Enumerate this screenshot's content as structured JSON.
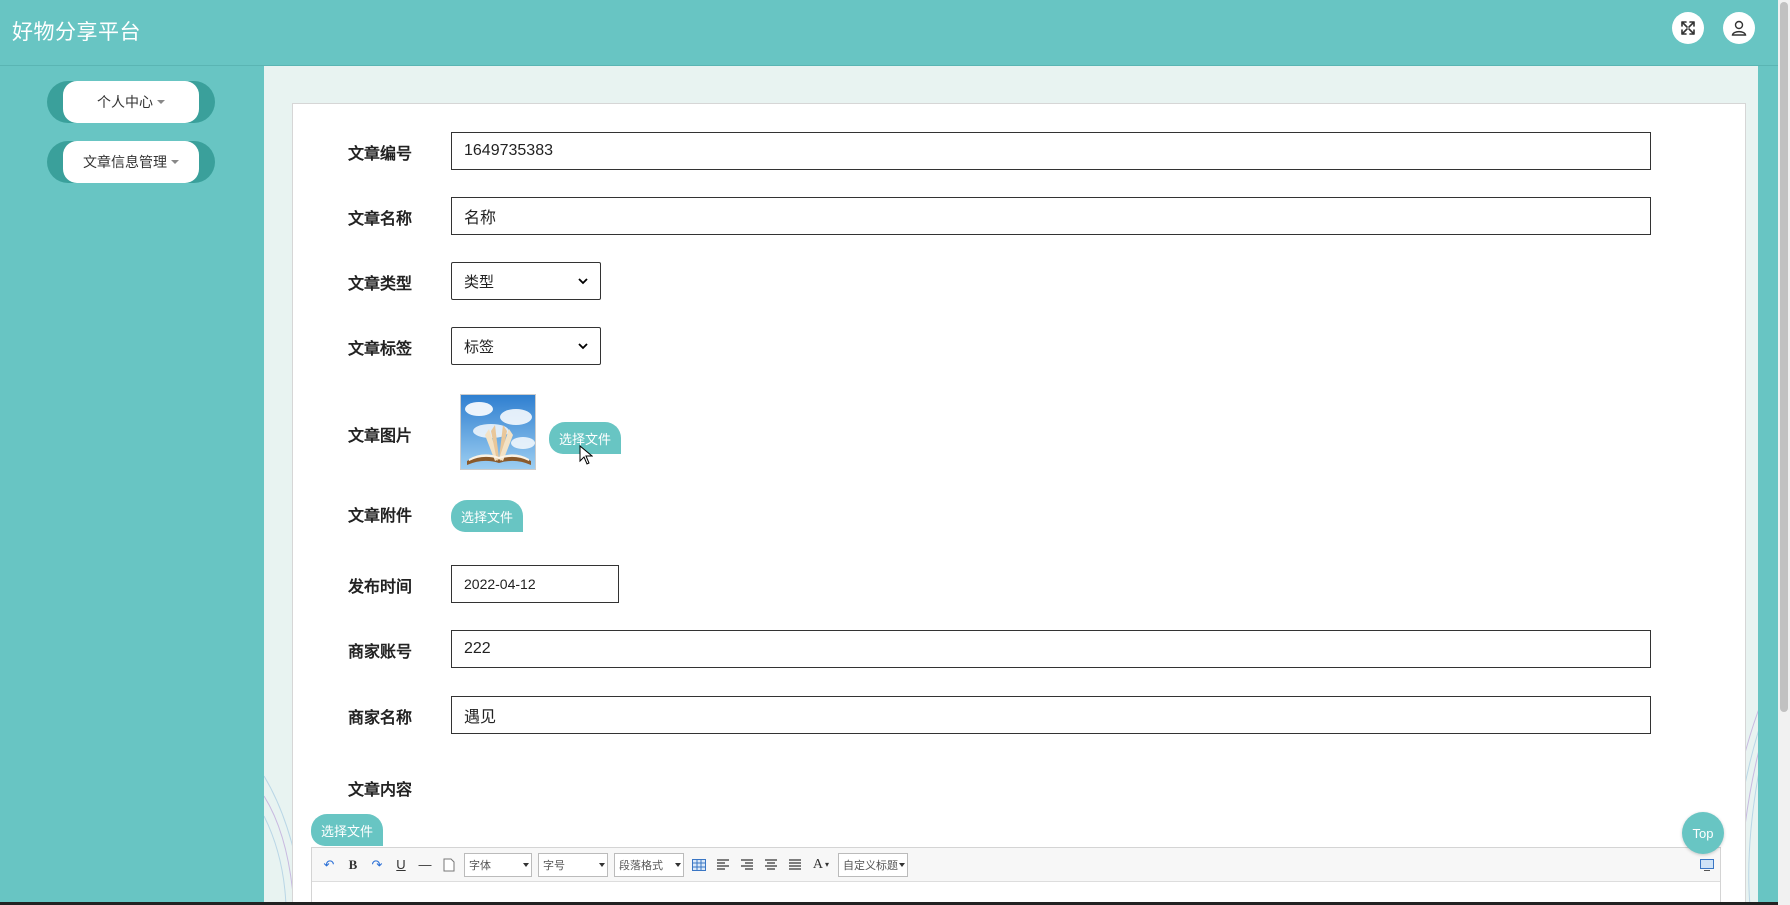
{
  "app": {
    "title": "好物分享平台"
  },
  "header": {
    "fullscreen_icon": "expand-icon",
    "user_icon": "user-icon"
  },
  "sidebar": {
    "items": [
      {
        "label": "个人中心"
      },
      {
        "label": "文章信息管理"
      }
    ]
  },
  "form": {
    "article_no": {
      "label": "文章编号",
      "value": "1649735383"
    },
    "article_name": {
      "label": "文章名称",
      "value": "名称"
    },
    "article_type": {
      "label": "文章类型",
      "value": "类型"
    },
    "article_tag": {
      "label": "文章标签",
      "value": "标签"
    },
    "article_image": {
      "label": "文章图片",
      "button": "选择文件"
    },
    "article_attachment": {
      "label": "文章附件",
      "button": "选择文件"
    },
    "publish_time": {
      "label": "发布时间",
      "value": "2022-04-12"
    },
    "merchant_account": {
      "label": "商家账号",
      "value": "222"
    },
    "merchant_name": {
      "label": "商家名称",
      "value": "遇见"
    },
    "article_content": {
      "label": "文章内容",
      "button": "选择文件"
    }
  },
  "editor": {
    "font_combo": "字体",
    "size_combo": "字号",
    "paragraph_combo": "段落格式",
    "custom_title_combo": "自定义标题"
  },
  "top_button": "Top",
  "colors": {
    "accent": "#68c5c3",
    "accent_dark": "#3aa09b",
    "main_bg": "#e8f3f1"
  }
}
